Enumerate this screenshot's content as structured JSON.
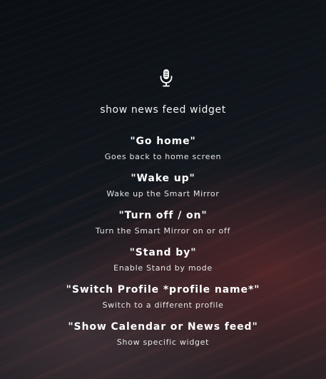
{
  "voice": {
    "mic_icon": "microphone-icon",
    "heard_text": "show news feed widget"
  },
  "commands": [
    {
      "title": "\"Go home\"",
      "description": "Goes back to home screen"
    },
    {
      "title": "\"Wake up\"",
      "description": "Wake up the Smart Mirror"
    },
    {
      "title": "\"Turn off / on\"",
      "description": "Turn the Smart Mirror on or off"
    },
    {
      "title": "\"Stand by\"",
      "description": "Enable Stand by mode"
    },
    {
      "title": "\"Switch Profile *profile name*\"",
      "description": "Switch to a different profile"
    },
    {
      "title": "\"Show Calendar or News feed\"",
      "description": "Show specific widget"
    }
  ],
  "colors": {
    "text": "#ffffff",
    "background_dark": "#0b0f14",
    "accent_red": "#782d2d"
  }
}
